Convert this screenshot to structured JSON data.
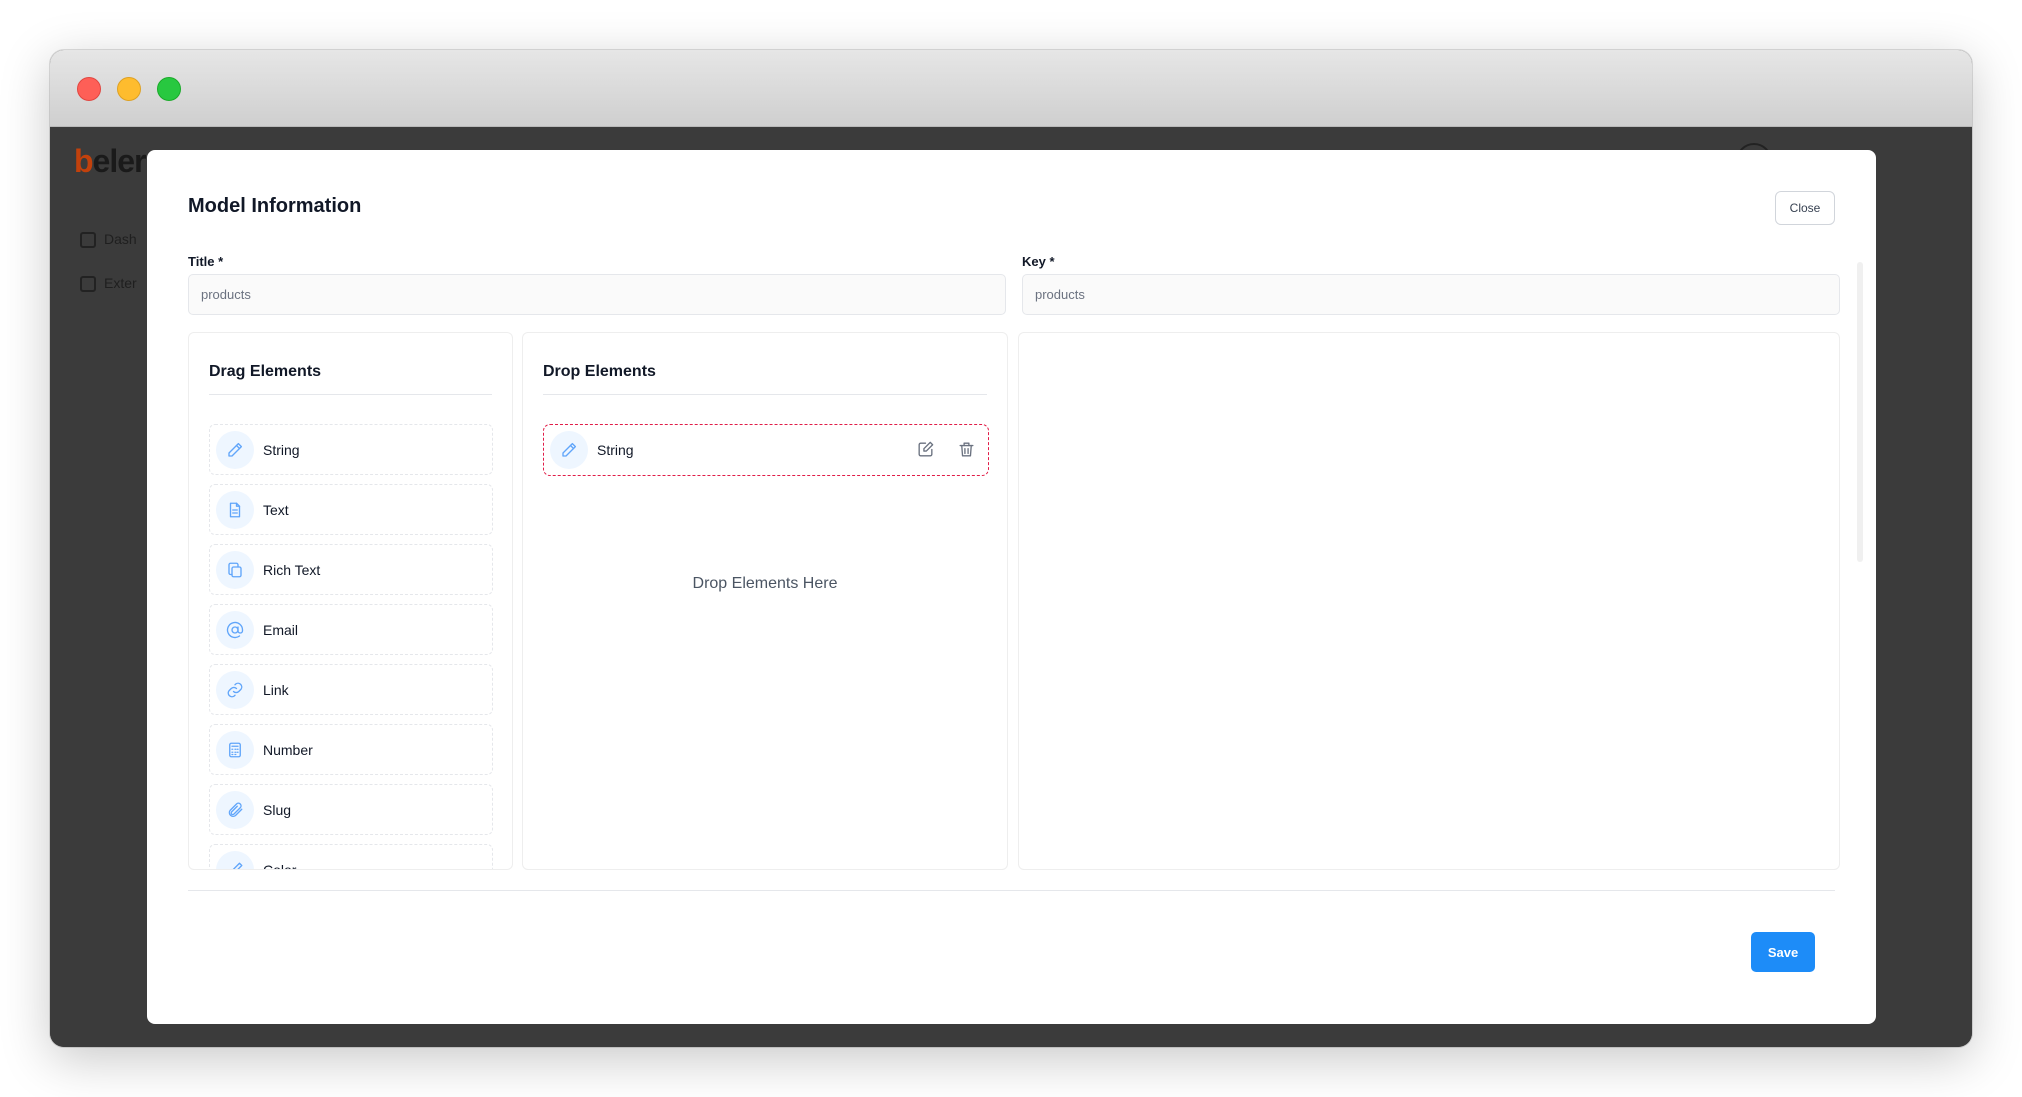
{
  "app": {
    "logo_text": "eler",
    "nav_items": [
      "Dash",
      "Exter"
    ]
  },
  "modal": {
    "title": "Model Information",
    "close_label": "Close",
    "title_field": {
      "label": "Title *",
      "value": "products"
    },
    "key_field": {
      "label": "Key *",
      "value": "products"
    },
    "drag_panel": {
      "heading": "Drag Elements",
      "items": [
        {
          "label": "String",
          "icon": "pencil-icon"
        },
        {
          "label": "Text",
          "icon": "document-icon"
        },
        {
          "label": "Rich Text",
          "icon": "copy-icon"
        },
        {
          "label": "Email",
          "icon": "at-icon"
        },
        {
          "label": "Link",
          "icon": "link-icon"
        },
        {
          "label": "Number",
          "icon": "calculator-icon"
        },
        {
          "label": "Slug",
          "icon": "paperclip-icon"
        },
        {
          "label": "Color",
          "icon": "pen-icon"
        }
      ]
    },
    "drop_panel": {
      "heading": "Drop Elements",
      "items": [
        {
          "label": "String",
          "icon": "pencil-icon"
        }
      ],
      "placeholder": "Drop Elements Here"
    },
    "save_label": "Save"
  }
}
